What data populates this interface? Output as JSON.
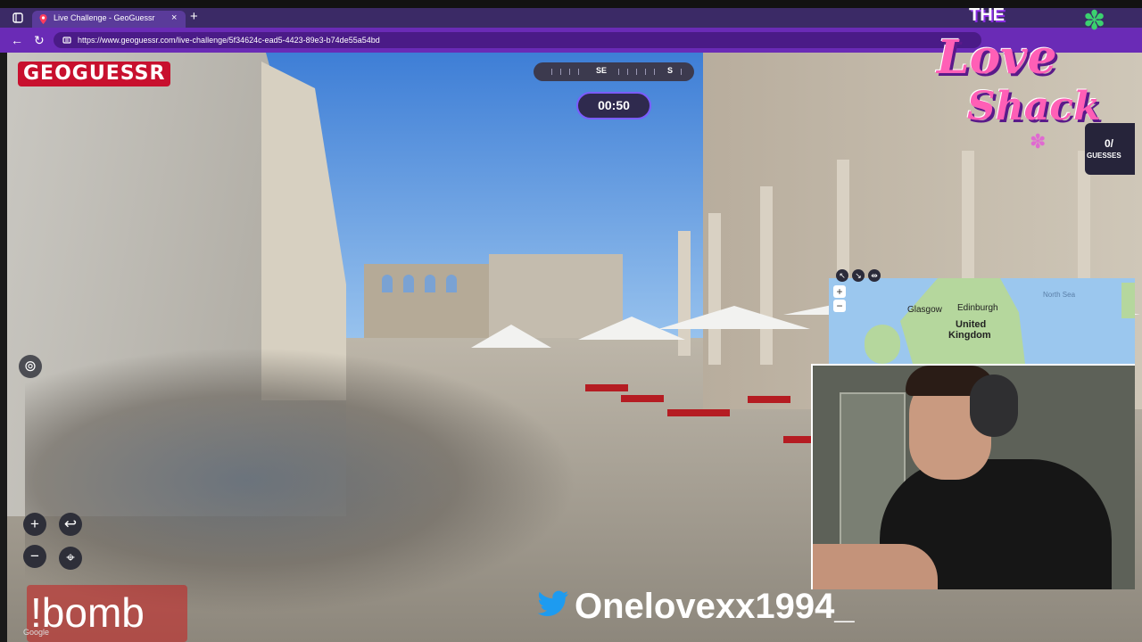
{
  "browser": {
    "tab_title": "Live Challenge - GeoGuessr",
    "tab_close": "×",
    "new_tab": "+",
    "url": "https://www.geoguessr.com/live-challenge/5f34624c-ead5-4423-89e3-b74de55a54bd"
  },
  "game": {
    "logo": "GEOGUESSR",
    "compass_left": "SE",
    "compass_right": "S",
    "timer": "00:50",
    "zoom_in": "+",
    "zoom_out": "−",
    "undo": "↩",
    "checkpoint": "⌖",
    "google_label": "Google",
    "guesses_count": "0/",
    "guesses_label": "GUESSES"
  },
  "map": {
    "zoom_in": "+",
    "zoom_out": "−",
    "tools": [
      "↖",
      "↘",
      "⇹"
    ],
    "labels": {
      "north_sea": "North Sea",
      "glasgow": "Glasgow",
      "edinburgh": "Edinburgh",
      "united": "United",
      "kingdom": "Kingdom"
    }
  },
  "overlay": {
    "love_the": "THE",
    "love_line1": "Love",
    "love_line2": "Shack",
    "bomb_command": "!bomb",
    "twitter_handle": "Onelovexx1994_"
  },
  "colors": {
    "tab_bar": "#3b2a66",
    "address_bar": "#6a2bb6",
    "accent": "#7a5cff",
    "logo_red": "#c8102e",
    "table_red": "#b51c22"
  }
}
